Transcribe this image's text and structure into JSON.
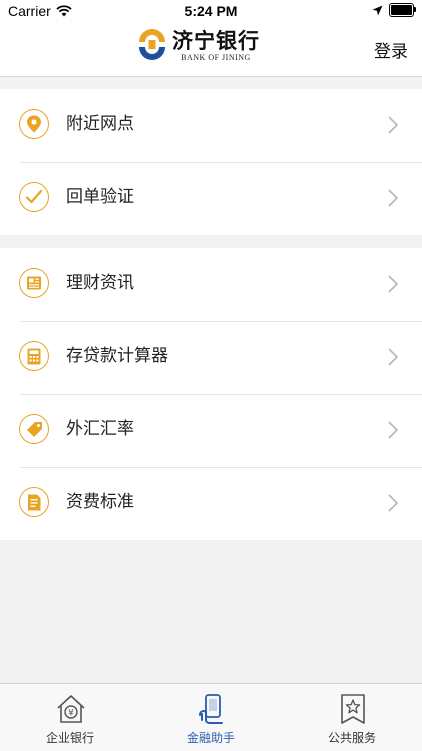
{
  "status_bar": {
    "carrier": "Carrier",
    "time": "5:24 PM"
  },
  "header": {
    "logo_cn": "济宁银行",
    "logo_en": "BANK OF JINING",
    "login": "登录"
  },
  "menu_group_1": [
    {
      "label": "附近网点",
      "icon": "location-pin-icon"
    },
    {
      "label": "回单验证",
      "icon": "checkmark-icon"
    }
  ],
  "menu_group_2": [
    {
      "label": "理财资讯",
      "icon": "newspaper-icon"
    },
    {
      "label": "存贷款计算器",
      "icon": "calculator-icon"
    },
    {
      "label": "外汇汇率",
      "icon": "price-tag-icon"
    },
    {
      "label": "资费标准",
      "icon": "document-icon"
    }
  ],
  "tabs": [
    {
      "label": "企业银行",
      "icon": "house-yuan-icon",
      "active": false
    },
    {
      "label": "金融助手",
      "icon": "phone-hand-icon",
      "active": true
    },
    {
      "label": "公共服务",
      "icon": "star-bookmark-icon",
      "active": false
    }
  ],
  "colors": {
    "accent": "#e8a423",
    "tab_active": "#2a5db0",
    "logo_blue": "#1f4f9c",
    "logo_orange": "#e8a423"
  }
}
